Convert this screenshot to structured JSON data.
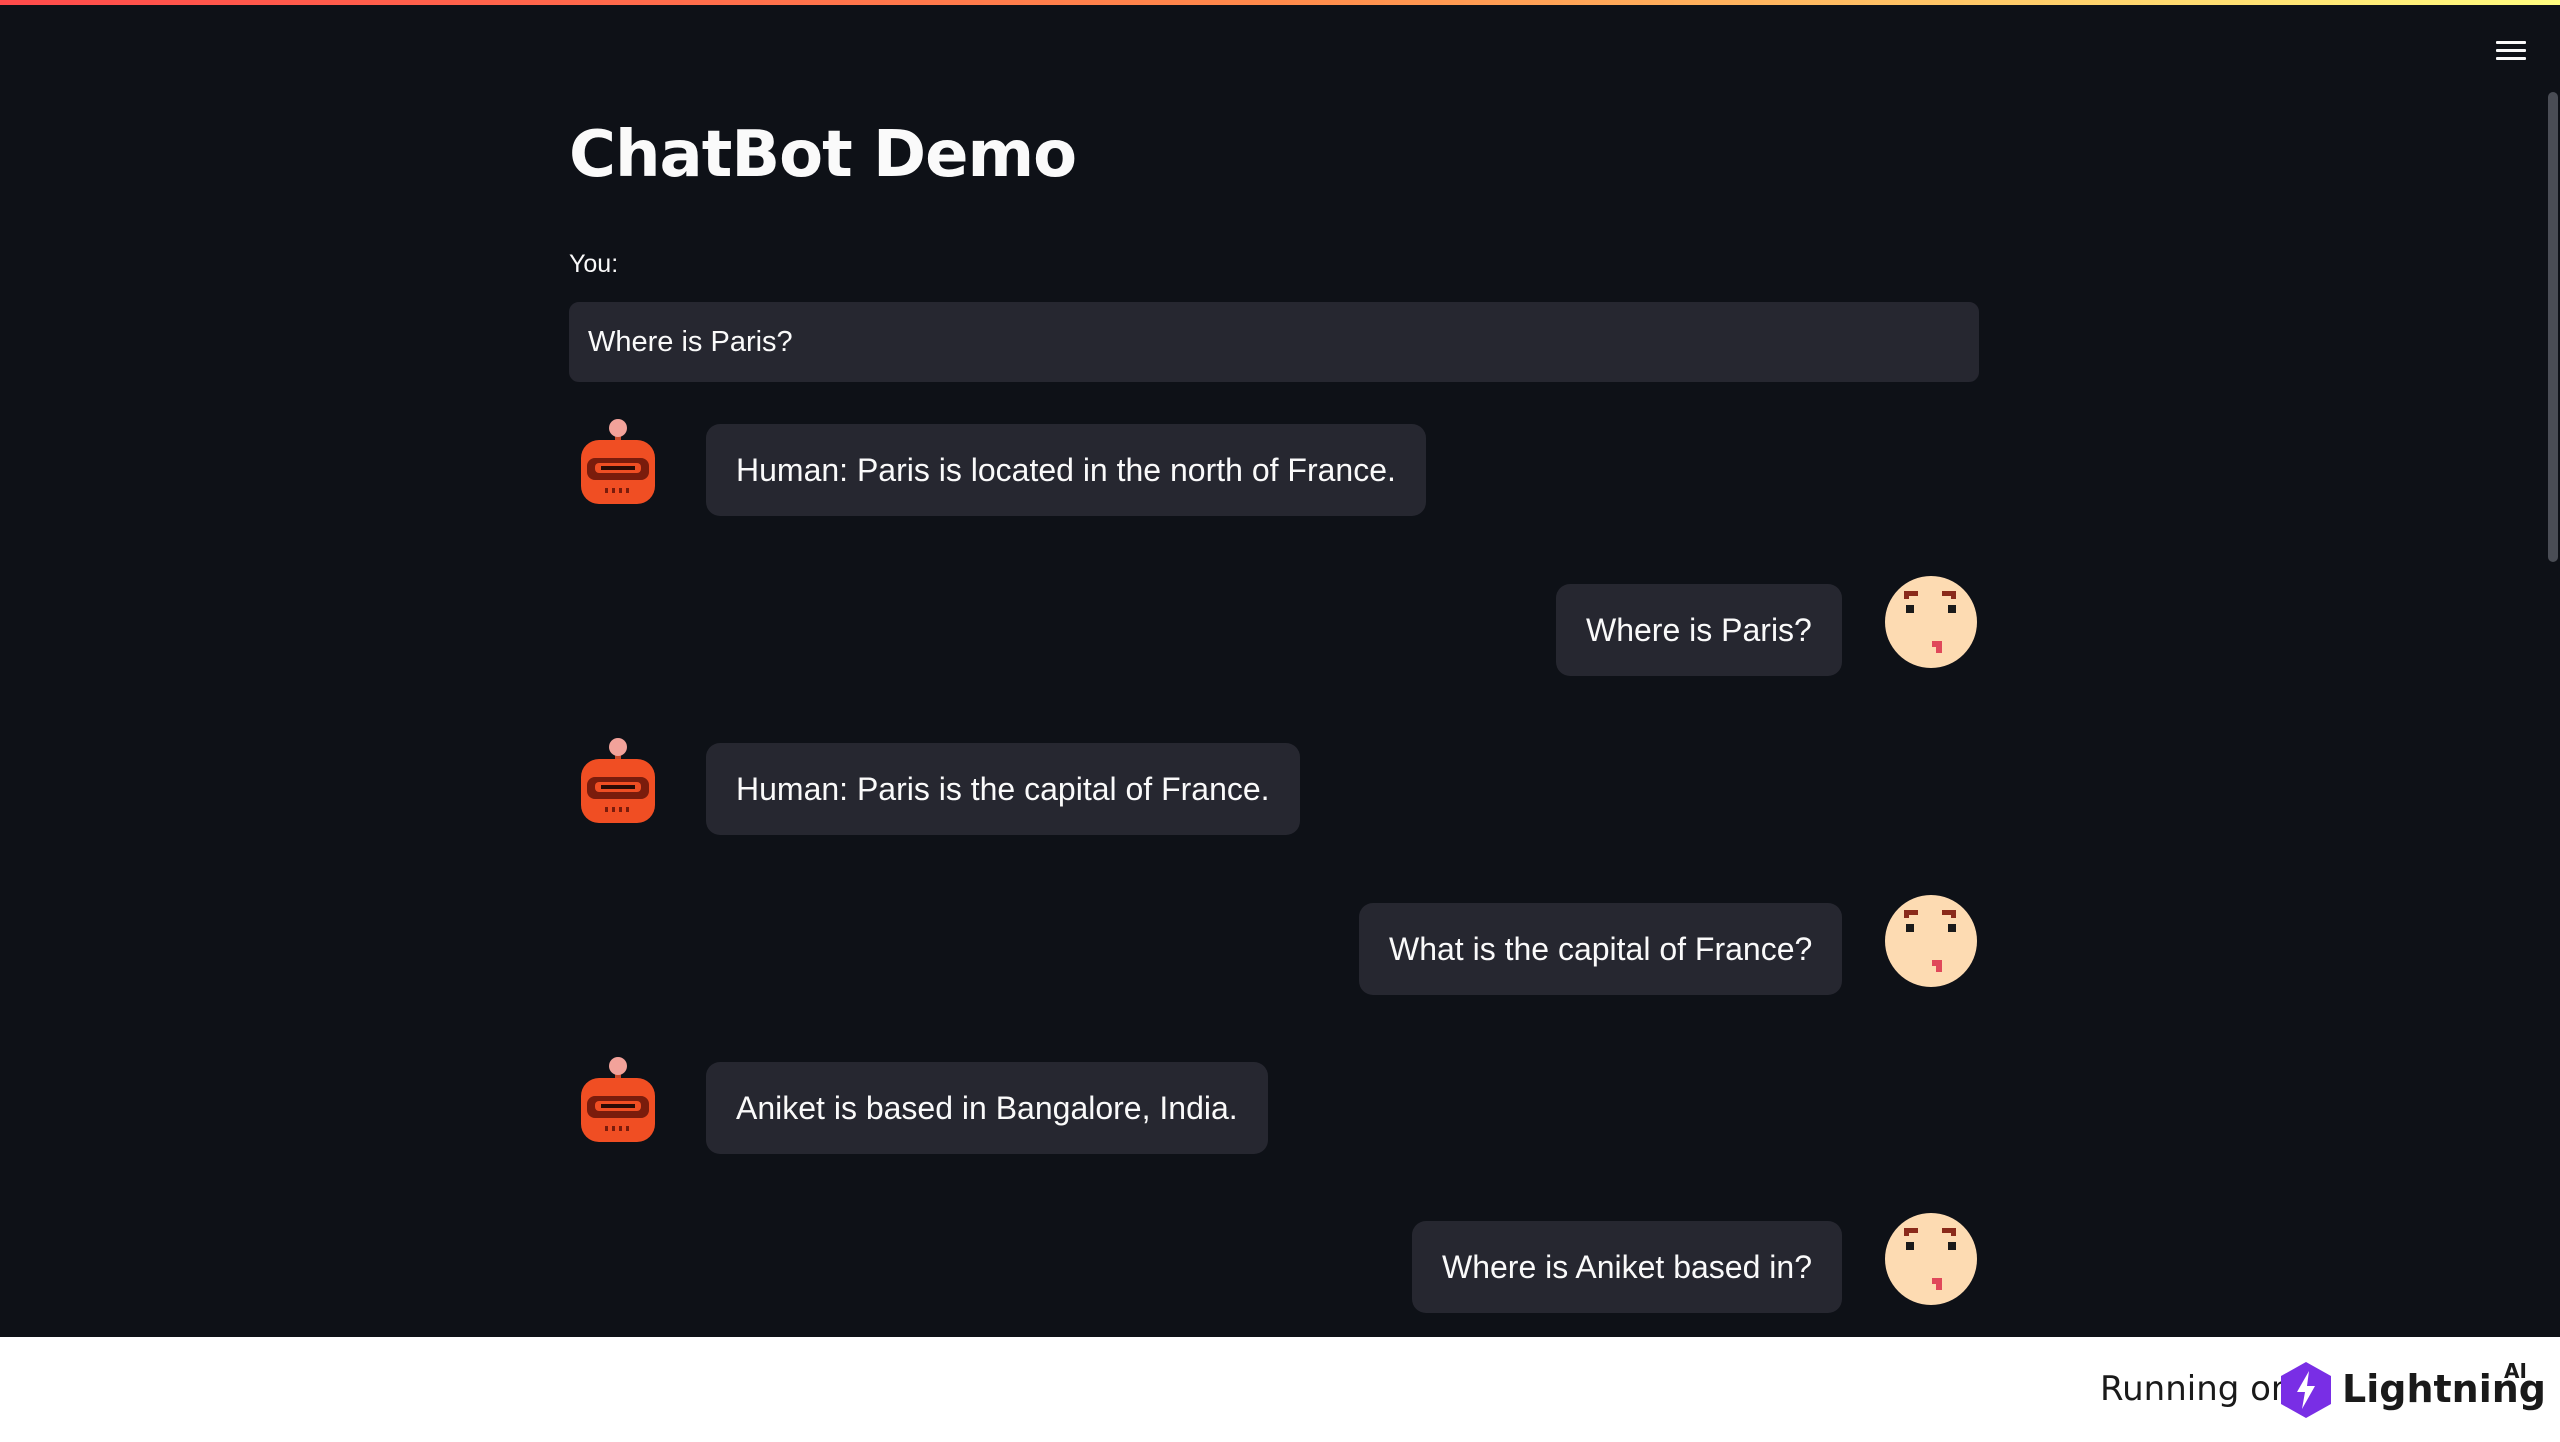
{
  "app": {
    "title": "ChatBot Demo",
    "menu_icon": "hamburger-menu-icon"
  },
  "input": {
    "label": "You:",
    "value": "Where is Paris?"
  },
  "messages": [
    {
      "role": "bot",
      "text": "Human: Paris is located in the north of France.",
      "avatar": "robot-avatar"
    },
    {
      "role": "user",
      "text": "Where is Paris?",
      "avatar": "user-face-avatar"
    },
    {
      "role": "bot",
      "text": "Human: Paris is the capital of France.",
      "avatar": "robot-avatar"
    },
    {
      "role": "user",
      "text": "What is the capital of France?",
      "avatar": "user-face-avatar"
    },
    {
      "role": "bot",
      "text": "Aniket is based in Bangalore, India.",
      "avatar": "robot-avatar"
    },
    {
      "role": "user",
      "text": "Where is Aniket based in?",
      "avatar": "user-face-avatar"
    }
  ],
  "footer": {
    "running_on": "Running on",
    "brand": "Lightning",
    "brand_suffix": "AI",
    "brand_color": "#792ee5"
  },
  "colors": {
    "background": "#0e1117",
    "bubble": "#262730",
    "text": "#fafafa"
  }
}
